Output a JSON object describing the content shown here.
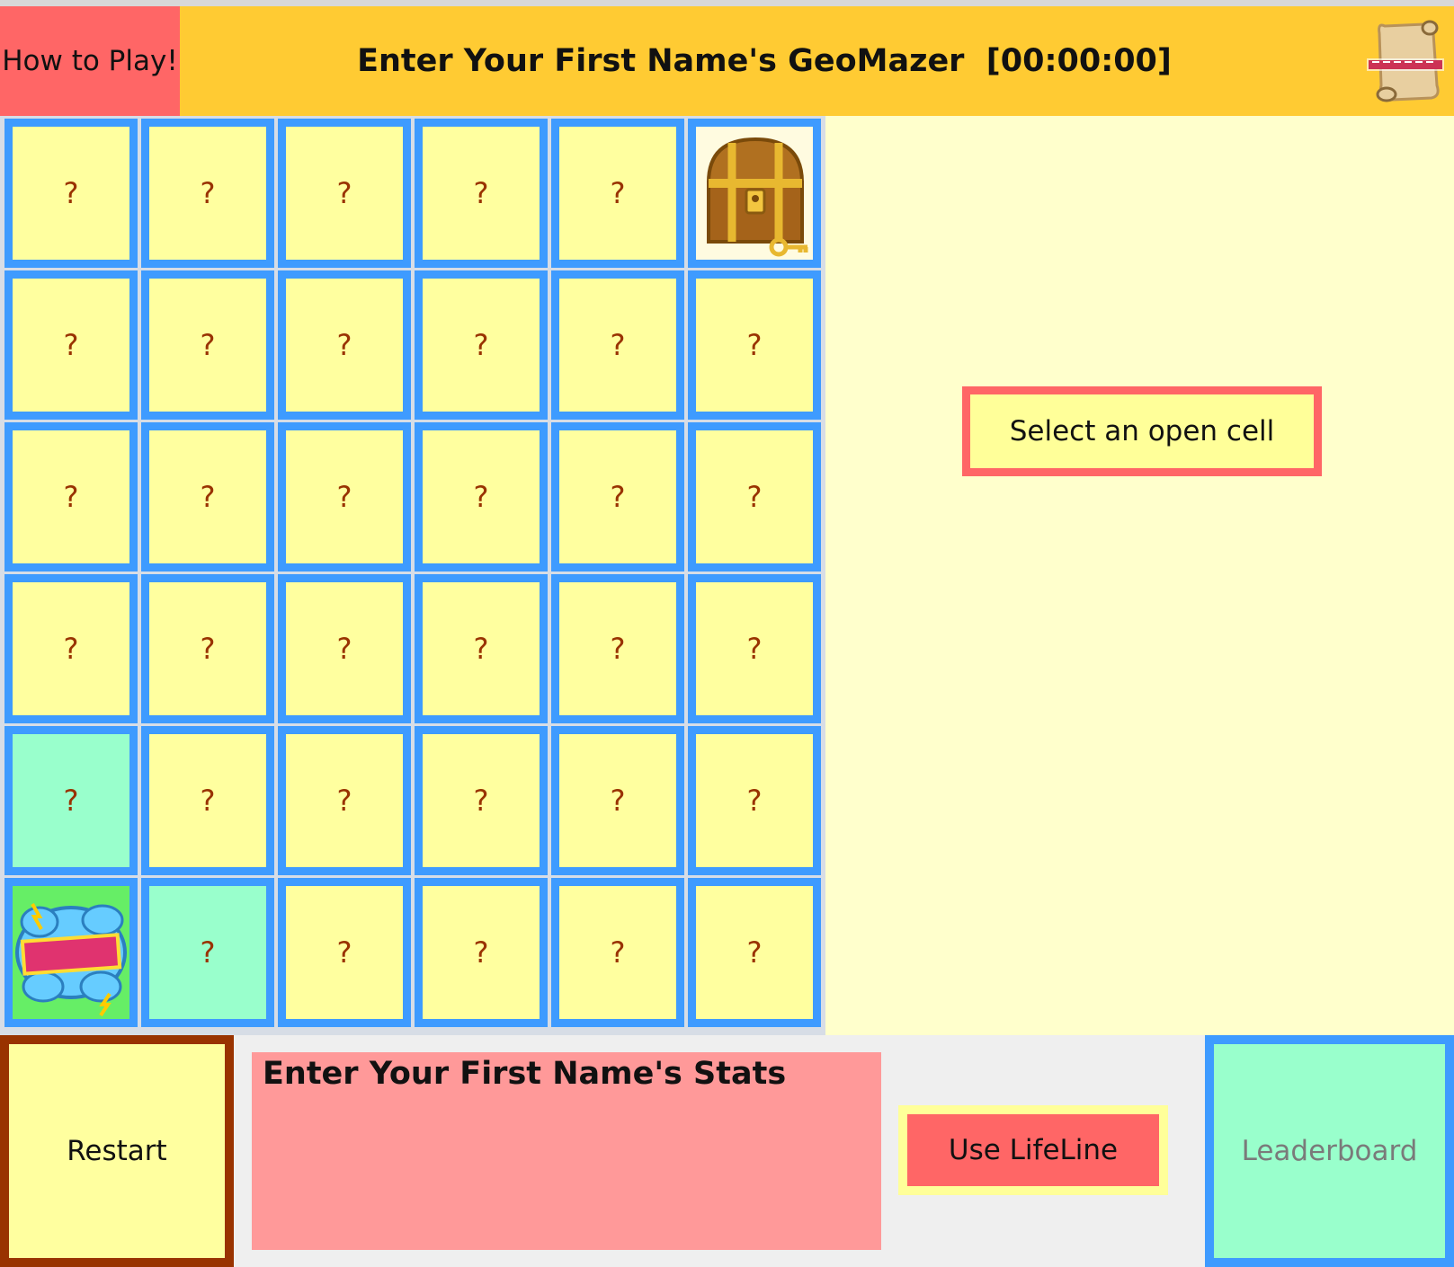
{
  "header": {
    "how_to_play": "How to Play!",
    "title": "Enter Your First Name's GeoMazer  [00:00:00]",
    "logo_icon": "geomazer-scroll-logo"
  },
  "board": {
    "rows": 6,
    "cols": 6,
    "cells": [
      [
        "?",
        "?",
        "?",
        "?",
        "?",
        "treasure"
      ],
      [
        "?",
        "?",
        "?",
        "?",
        "?",
        "?"
      ],
      [
        "?",
        "?",
        "?",
        "?",
        "?",
        "?"
      ],
      [
        "?",
        "?",
        "?",
        "?",
        "?",
        "?"
      ],
      [
        "?",
        "?",
        "?",
        "?",
        "?",
        "?"
      ],
      [
        "start",
        "?",
        "?",
        "?",
        "?",
        "?"
      ]
    ],
    "open_cells": [
      [
        4,
        0
      ],
      [
        5,
        1
      ]
    ],
    "colors": {
      "cell": "#ffff9f",
      "open_cell": "#99ffcc",
      "cell_border": "#3e9bff",
      "question_mark": "#993300"
    }
  },
  "message": "Select an open cell",
  "footer": {
    "restart": "Restart",
    "stats_title": "Enter Your First Name's Stats",
    "lifeline": "Use LifeLine",
    "leaderboard": "Leaderboard"
  },
  "colors": {
    "header_bg": "#ffcb33",
    "how_to_play_bg": "#ff6666",
    "side_bg": "#ffffcc",
    "stats_bg": "#ff9999"
  }
}
